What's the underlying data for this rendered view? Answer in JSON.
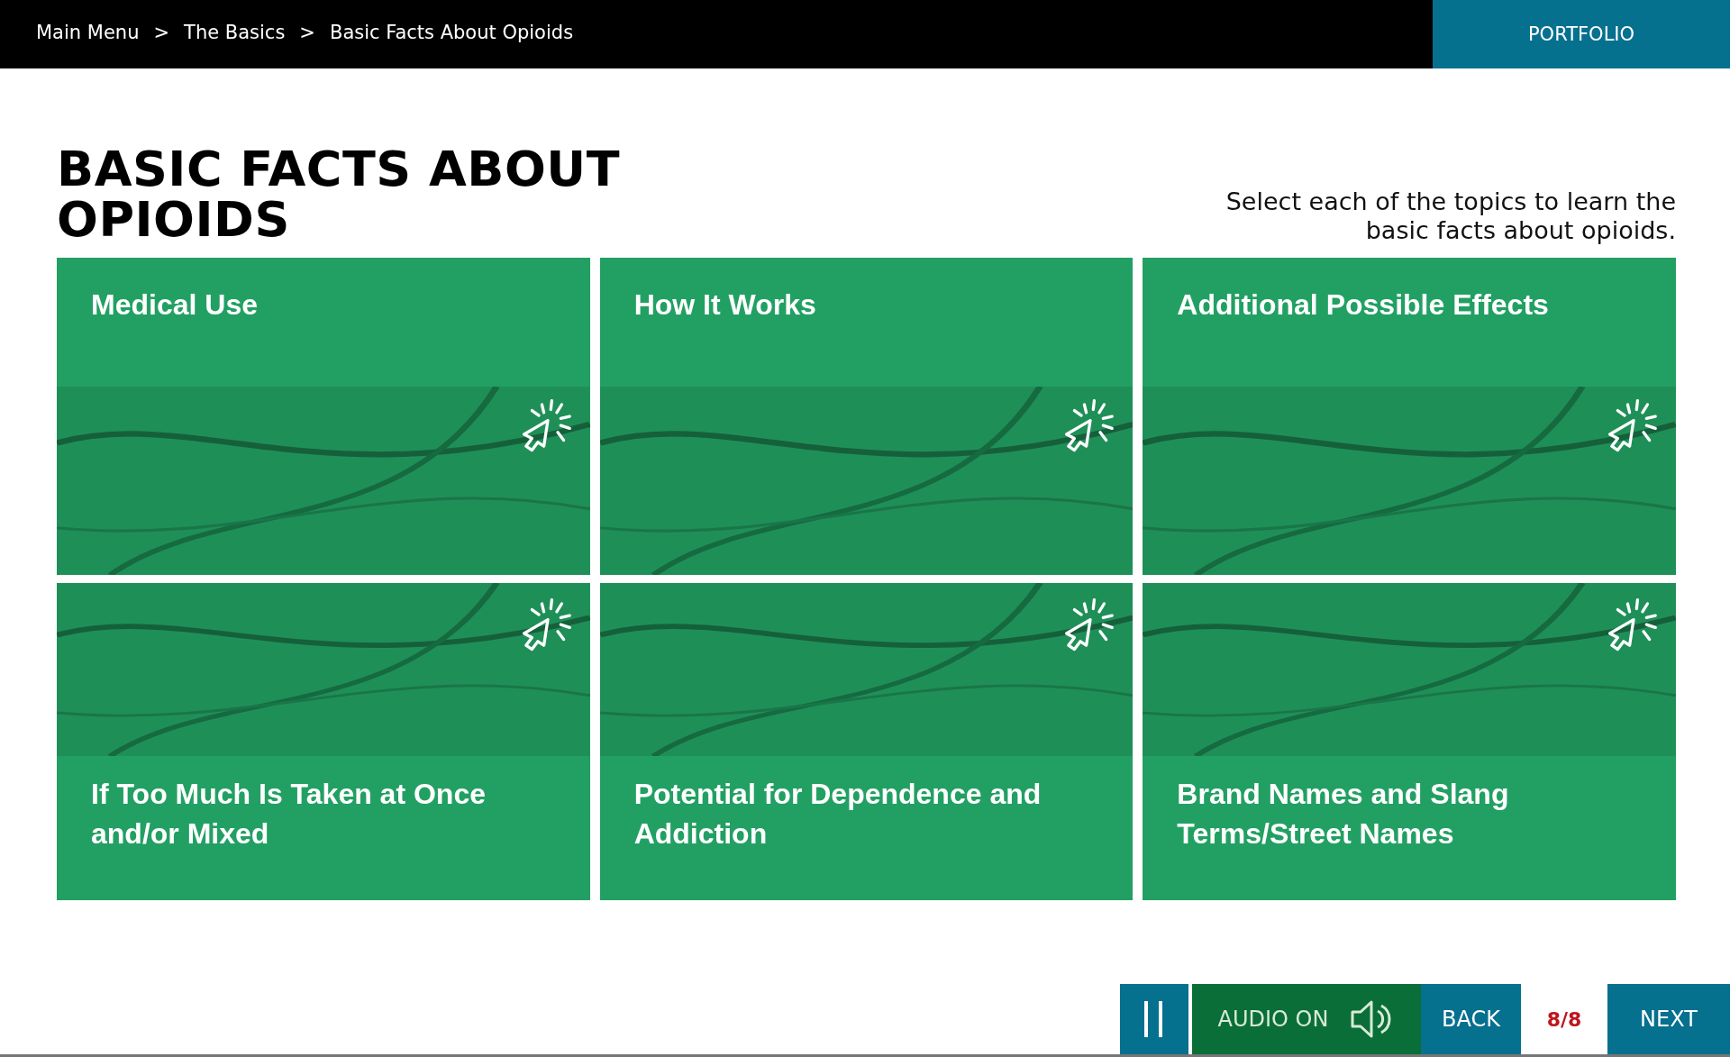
{
  "breadcrumb": [
    {
      "label": "Main Menu",
      "separator": ">"
    },
    {
      "label": "The Basics",
      "separator": ">"
    },
    {
      "label": "Basic Facts About Opioids"
    }
  ],
  "portfolio_button": "PORTFOLIO",
  "title": "BASIC FACTS ABOUT OPIOIDS",
  "instruction": "Select each of the topics to learn the basic facts about opioids.",
  "topics": [
    {
      "label": "Medical Use",
      "kind": "top-title"
    },
    {
      "label": "How It Works",
      "kind": "top-title"
    },
    {
      "label": "Additional Possible Effects",
      "kind": "top-title"
    },
    {
      "label": "If Too Much Is Taken at Once and/or Mixed",
      "kind": "bottom-title"
    },
    {
      "label": "Potential for Dependence and Addiction",
      "kind": "bottom-title"
    },
    {
      "label": "Brand Names and Slang Terms/Street Names",
      "kind": "bottom-title"
    }
  ],
  "controls": {
    "audio": {
      "label": "AUDIO ON",
      "on": true
    },
    "back": "BACK",
    "counter": "8/8",
    "next": "NEXT"
  }
}
